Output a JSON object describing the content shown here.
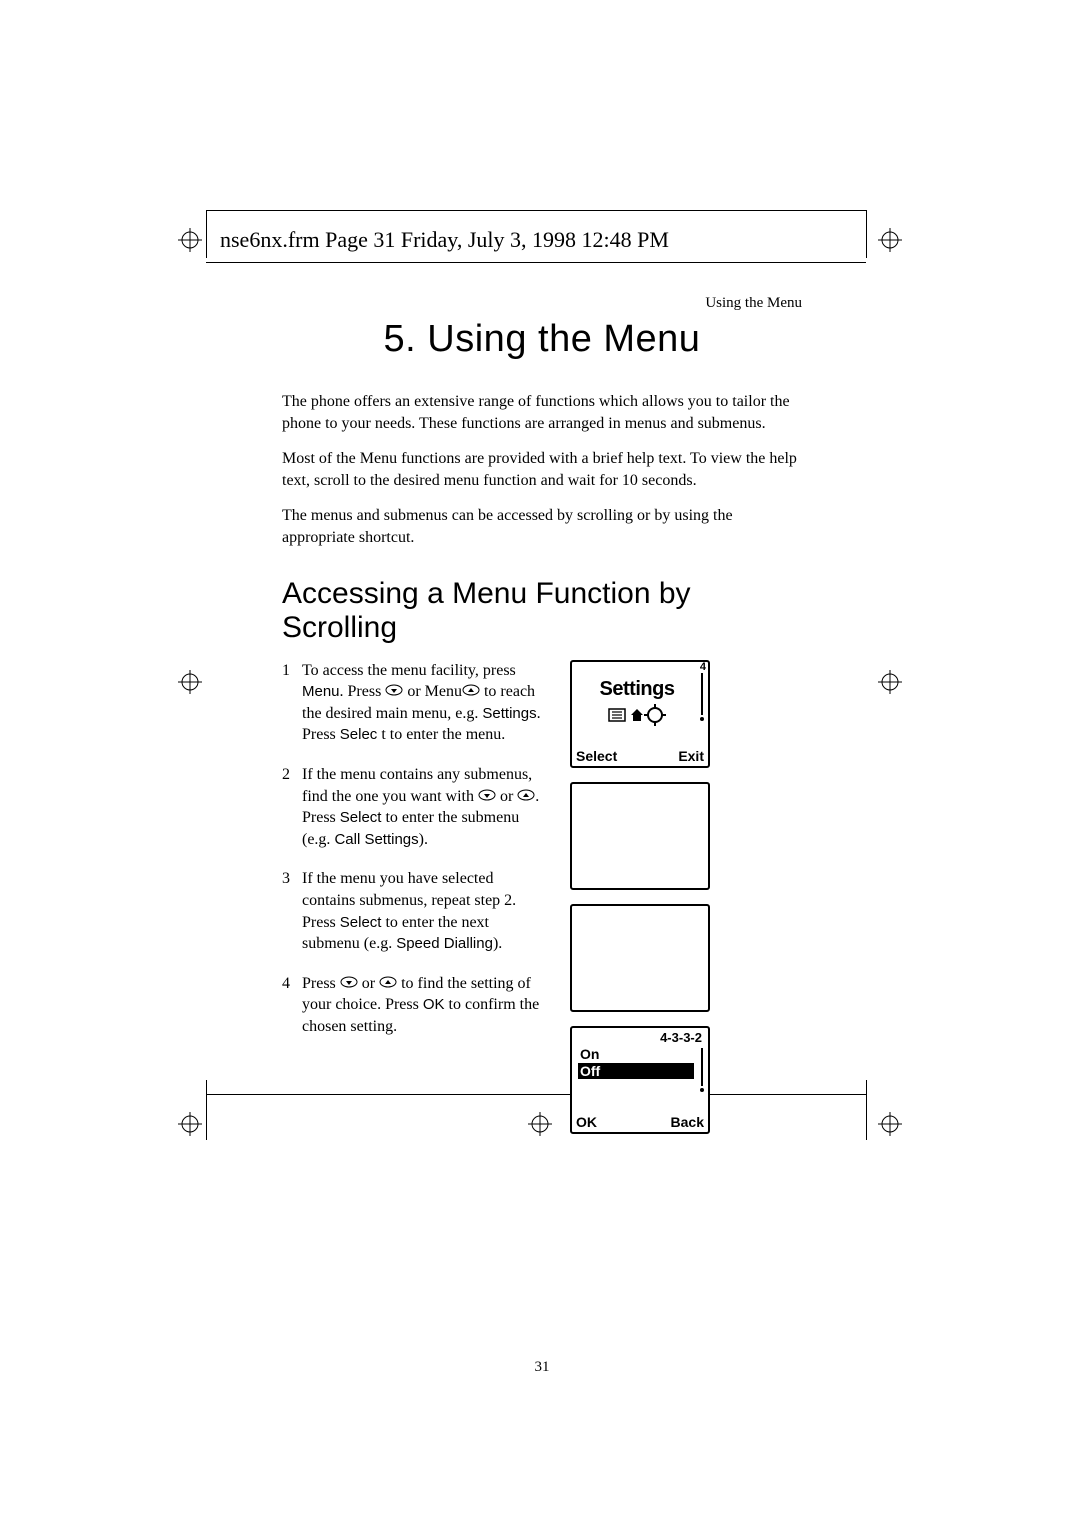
{
  "slug": "nse6nx.frm  Page 31  Friday, July 3, 1998  12:48 PM",
  "running_head": "Using the Menu",
  "chapter_title": "5. Using the Menu",
  "intro": {
    "p1": "The phone offers an extensive range of functions which allows you to tailor the phone to your needs. These functions are arranged in menus and submenus.",
    "p2": "Most of the Menu functions are provided with a brief help text. To view the help text, scroll to the desired menu function and wait for 10 seconds.",
    "p3": "The menus and submenus can be accessed by scrolling or by using the appropriate shortcut."
  },
  "section_heading": "Accessing a Menu Function by Scrolling",
  "steps": {
    "s1a": "To access the menu facility, press ",
    "s1_menu": "Menu",
    "s1b": ". Press ",
    "s1c": " or Menu",
    "s1d": " to reach the desired main menu, e.g. ",
    "s1_settings": "Settings",
    "s1e": ". Press ",
    "s1_select": "Selec",
    "s1f": " t to enter the menu.",
    "s2a": "If the menu contains any submenus, find the one you want with ",
    "s2b": " or ",
    "s2c": ". Press ",
    "s2_select": "Select",
    "s2d": " to enter the submenu (e.g. ",
    "s2_call": "Call Settings",
    "s2e": ").",
    "s3a": "If the menu you have selected contains submenus, repeat step 2. Press ",
    "s3_select": "Select",
    "s3b": " to enter the next submenu (e.g. ",
    "s3_speed": "Speed Dialling",
    "s3c": ").",
    "s4a": "Press ",
    "s4b": " or ",
    "s4c": " to find the setting of your choice. Press ",
    "s4_ok": "OK",
    "s4d": " to confirm the chosen setting."
  },
  "screens": {
    "settings": {
      "indicator": "4",
      "title": "Settings",
      "left_softkey": "Select",
      "right_softkey": "Exit"
    },
    "onoff": {
      "breadcrumb": "4-3-3-2",
      "option1": "On",
      "option2": "Off",
      "left_softkey": "OK",
      "right_softkey": "Back"
    }
  },
  "page_number": "31"
}
